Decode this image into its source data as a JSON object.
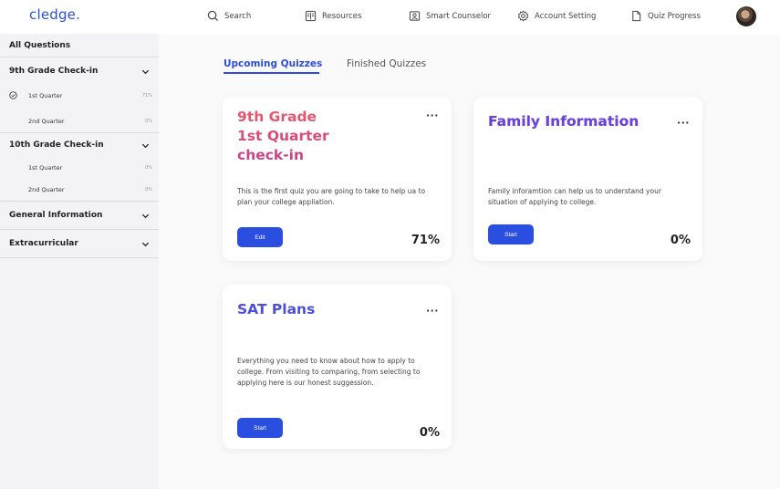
{
  "app": {
    "logo": "cledge."
  },
  "nav": [
    {
      "label": "Search",
      "icon": "search-icon"
    },
    {
      "label": "Resources",
      "icon": "resources-icon"
    },
    {
      "label": "Smart Counselor",
      "icon": "counselor-icon"
    },
    {
      "label": "Account Setting",
      "icon": "gear-icon"
    },
    {
      "label": "Quiz Progress",
      "icon": "document-icon"
    }
  ],
  "sidebar": {
    "heading": "All Questions",
    "groups": [
      {
        "title": "9th Grade Check-in",
        "items": [
          {
            "label": "1st Quarter",
            "progress": "71%",
            "checked": true
          },
          {
            "label": "2nd Quarter",
            "progress": "0%"
          }
        ]
      },
      {
        "title": "10th Grade Check-in",
        "items": [
          {
            "label": "1st Quarter",
            "progress": "0%"
          },
          {
            "label": "2nd Quarter",
            "progress": "0%"
          }
        ]
      },
      {
        "title": "General Information",
        "items": []
      },
      {
        "title": "Extracurricular",
        "items": []
      }
    ]
  },
  "tabs": {
    "upcoming": "Upcoming Quizzes",
    "finished": "Finished Quizzes"
  },
  "cards": [
    {
      "title_lines": [
        "9th Grade",
        "1st Quarter",
        "check-in"
      ],
      "description": "This is the first quiz you are going to take to help ua to plan your college appliation.",
      "button": "Edit",
      "progress": "71%"
    },
    {
      "title": "Family Information",
      "description": "Family inforamtion can help us to understand your situation of applying to college.",
      "button": "Start",
      "progress": "0%"
    },
    {
      "title": "SAT Plans",
      "description": "Everything you need to know about how to apply to college. From visiting to comparing, from selecting to applying here is our honest suggession.",
      "button": "Start",
      "progress": "0%"
    }
  ],
  "more_glyph": "···"
}
